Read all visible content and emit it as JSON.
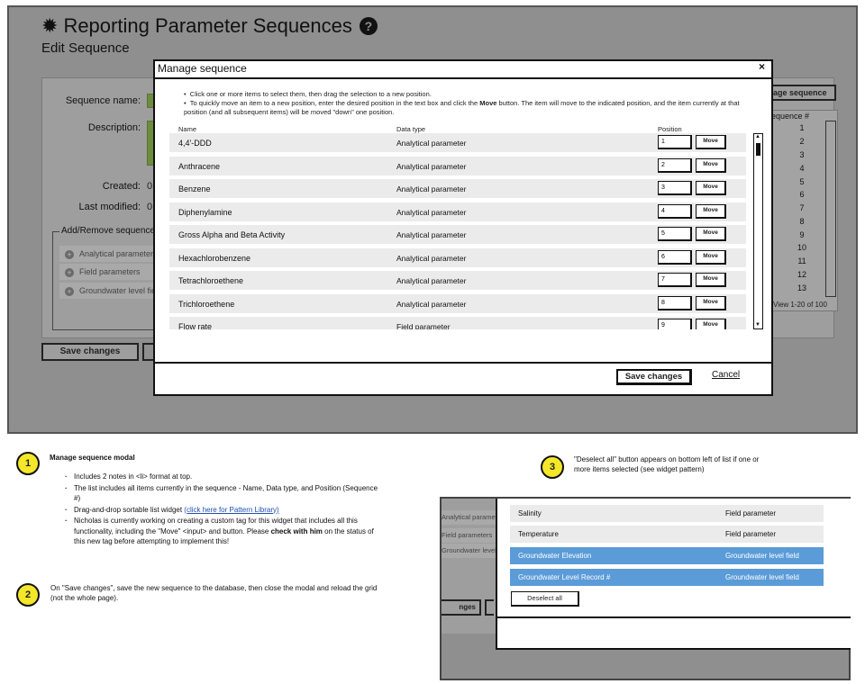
{
  "page": {
    "title": "Reporting Parameter Sequences",
    "subtitle": "Edit Sequence"
  },
  "background_form": {
    "sequence_name_label": "Sequence name:",
    "description_label": "Description:",
    "created_label": "Created:",
    "created_value": "0",
    "last_modified_label": "Last modified:",
    "last_modified_value": "0",
    "add_remove_title": "Add/Remove sequence",
    "add_remove_items": [
      "Analytical parameters",
      "Field parameters",
      "Groundwater level fields"
    ],
    "save_label": "Save changes",
    "right_button_label": "age sequence",
    "sequence_col_header": "equence #",
    "sequence_numbers": [
      "1",
      "2",
      "3",
      "4",
      "5",
      "6",
      "7",
      "8",
      "9",
      "10",
      "11",
      "12",
      "13"
    ],
    "pager_text": "View 1-20 of 100"
  },
  "modal": {
    "title": "Manage sequence",
    "close_symbol": "×",
    "notes": [
      "Click one or more items to select them, then drag the selection to a new position.",
      "To quickly move an item to a new position, enter the desired position in the text box and click the",
      "Move",
      "button.  The item will move to the indicated position, and the item currently at that position (and all subsequent items) will be moved \"down\" one position."
    ],
    "columns": {
      "name": "Name",
      "data_type": "Data type",
      "position": "Position"
    },
    "move_label": "Move",
    "rows": [
      {
        "name": "4,4'-DDD",
        "data_type": "Analytical parameter",
        "position": "1"
      },
      {
        "name": "Anthracene",
        "data_type": "Analytical parameter",
        "position": "2"
      },
      {
        "name": "Benzene",
        "data_type": "Analytical parameter",
        "position": "3"
      },
      {
        "name": "Diphenylamine",
        "data_type": "Analytical parameter",
        "position": "4"
      },
      {
        "name": "Gross Alpha and Beta Activity",
        "data_type": "Analytical parameter",
        "position": "5"
      },
      {
        "name": "Hexachlorobenzene",
        "data_type": "Analytical parameter",
        "position": "6"
      },
      {
        "name": "Tetrachloroethene",
        "data_type": "Analytical parameter",
        "position": "7"
      },
      {
        "name": "Trichloroethene",
        "data_type": "Analytical parameter",
        "position": "8"
      },
      {
        "name": "Flow rate",
        "data_type": "Field parameter",
        "position": "9"
      }
    ],
    "save_label": "Save changes",
    "cancel_label": "Cancel"
  },
  "annotations": {
    "note1": {
      "number": "1",
      "title": "Manage sequence modal",
      "bullet1": "Includes 2 notes in <li> format at top.",
      "bullet2": "The list includes all items currently in the sequence - Name, Data type, and Position (Sequence #)",
      "bullet3_prefix": "Drag-and-drop sortable list widget ",
      "bullet3_link": "(click here for Pattern Library)",
      "bullet4_prefix": "Nicholas is currently working on creating a custom tag for this widget that includes all this functionality, including the \"Move\" <input> and button.  Please ",
      "bullet4_bold": "check with him",
      "bullet4_suffix": " on the status of this new tag before attempting to implement this!"
    },
    "note2": {
      "number": "2",
      "text": "On \"Save changes\", save the new sequence to the database, then close the modal and reload the grid (not the whole page)."
    },
    "note3": {
      "number": "3",
      "text": "\"Deselect all\" button appears on bottom left of list if one or more items selected (see widget pattern)"
    }
  },
  "mini_example": {
    "left_items": [
      "Analytical parameters",
      "Field parameters",
      "Groundwater level fields"
    ],
    "left_button": "nges",
    "rows": [
      {
        "name": "Salinity",
        "data_type": "Field parameter",
        "selected": false
      },
      {
        "name": "Temperature",
        "data_type": "Field parameter",
        "selected": false
      },
      {
        "name": "Groundwater Elevation",
        "data_type": "Groundwater level field",
        "selected": true
      },
      {
        "name": "Groundwater Level Record #",
        "data_type": "Groundwater level field",
        "selected": true
      }
    ],
    "deselect_label": "Deselect all"
  },
  "colors": {
    "overlay_grey": "#8f8f8f",
    "field_green": "#6d8c3c",
    "selection_blue": "#5a9bd8",
    "badge_yellow": "#f4e72a",
    "link_blue": "#1f4fb0"
  },
  "icons": {
    "title_icon": "gear-icon",
    "help_icon": "question-circle-icon",
    "add_icon": "plus-circle-icon",
    "close_icon": "close-icon"
  }
}
